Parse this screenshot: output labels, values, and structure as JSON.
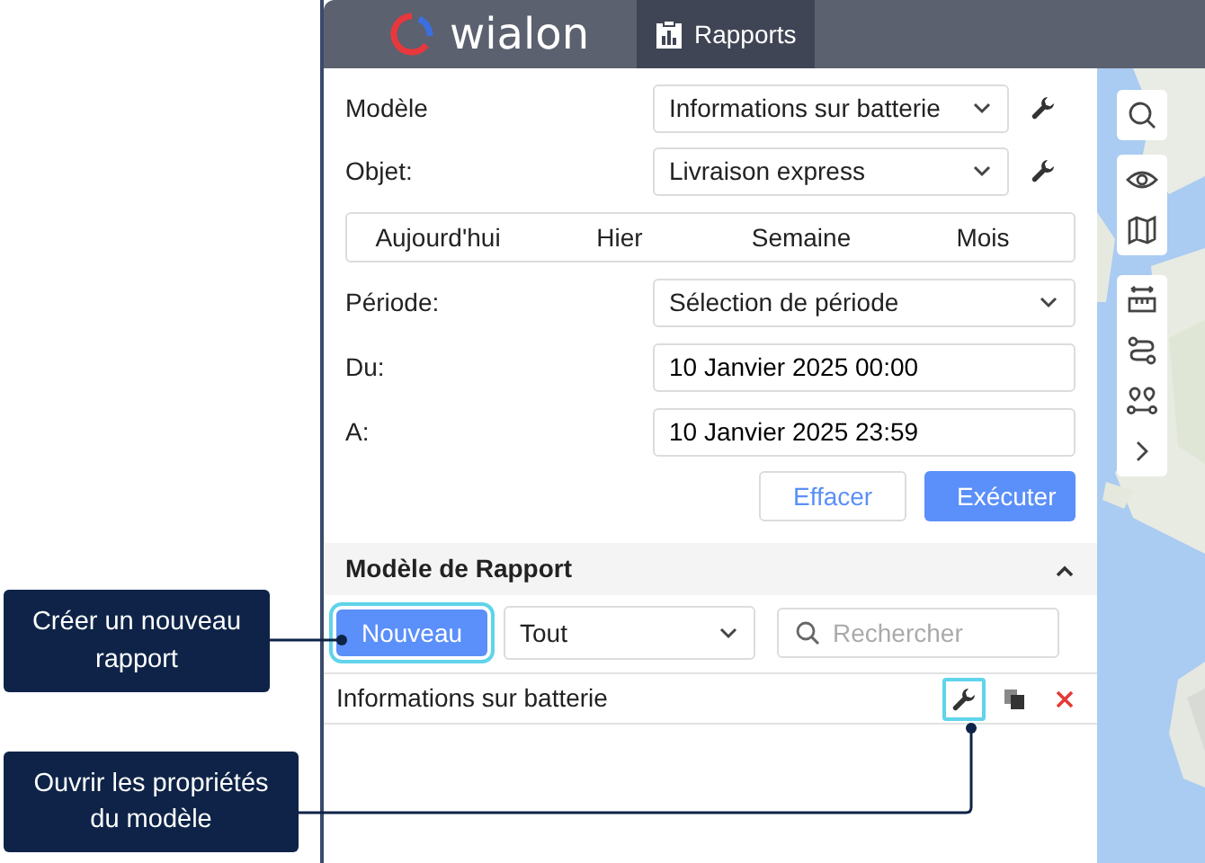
{
  "header": {
    "logo": "wialon",
    "tab": {
      "label": "Rapports",
      "selected": true
    }
  },
  "form": {
    "fields": [
      {
        "kind": "select",
        "label": "Modèle",
        "value": "Informations sur batterie",
        "tool": true
      },
      {
        "kind": "select",
        "label": "Objet:",
        "value": "Livraison express",
        "tool": true
      }
    ],
    "periods": [
      {
        "label": "Aujourd'hui",
        "selected": false
      },
      {
        "label": "Hier",
        "selected": false
      },
      {
        "label": "Semaine",
        "selected": false
      },
      {
        "label": "Mois",
        "selected": false
      }
    ],
    "range": [
      {
        "kind": "select",
        "label": "Période:",
        "value": "Sélection de période"
      },
      {
        "kind": "input",
        "label": "Du:",
        "value": "10 Janvier 2025 00:00"
      },
      {
        "kind": "input",
        "label": "A:",
        "value": "10 Janvier 2025 23:59"
      }
    ],
    "buttons": [
      {
        "label": "Effacer",
        "kind": "secondary"
      },
      {
        "label": "Exécuter",
        "kind": "primary"
      }
    ]
  },
  "template_section": {
    "title": "Modèle de Rapport",
    "expanded": true,
    "new_button": {
      "label": "Nouveau",
      "highlighted": true
    },
    "filter": {
      "value": "Tout"
    },
    "search": {
      "placeholder": "Rechercher"
    },
    "rows": [
      {
        "name": "Informations sur batterie",
        "actions": [
          {
            "kind": "properties",
            "highlighted": true
          },
          {
            "kind": "copy",
            "highlighted": false
          },
          {
            "kind": "delete",
            "highlighted": false
          }
        ]
      }
    ]
  },
  "callouts": [
    {
      "text": "Créer un nouveau rapport"
    },
    {
      "text": "Ouvrir les propriétés du modèle"
    }
  ]
}
